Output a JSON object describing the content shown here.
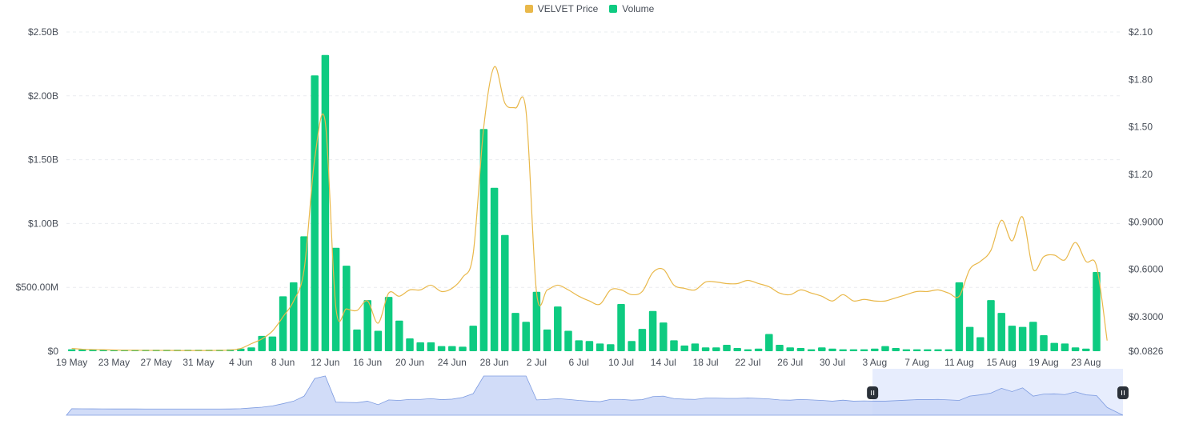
{
  "colors": {
    "price": "#f0b90b",
    "volume": "#0ecb81",
    "grid": "#eaecef",
    "navigator_fill": "#c9d6f7",
    "navigator_line": "#7d9be0",
    "navigator_window": "#e7edfd",
    "handle": "#2b3139"
  },
  "legend": [
    {
      "label": "VELVET Price",
      "color": "#e9b84a"
    },
    {
      "label": "Volume",
      "color": "#0ecb81"
    }
  ],
  "chart_data": {
    "type": "bar",
    "categories": [
      "19 May",
      "20 May",
      "21 May",
      "22 May",
      "23 May",
      "24 May",
      "25 May",
      "26 May",
      "27 May",
      "28 May",
      "29 May",
      "30 May",
      "31 May",
      "1 Jun",
      "2 Jun",
      "3 Jun",
      "4 Jun",
      "5 Jun",
      "6 Jun",
      "7 Jun",
      "8 Jun",
      "9 Jun",
      "10 Jun",
      "11 Jun",
      "12 Jun",
      "13 Jun",
      "14 Jun",
      "15 Jun",
      "16 Jun",
      "17 Jun",
      "18 Jun",
      "19 Jun",
      "20 Jun",
      "21 Jun",
      "22 Jun",
      "23 Jun",
      "24 Jun",
      "25 Jun",
      "26 Jun",
      "27 Jun",
      "28 Jun",
      "29 Jun",
      "30 Jun",
      "1 Jul",
      "2 Jul",
      "3 Jul",
      "4 Jul",
      "5 Jul",
      "6 Jul",
      "7 Jul",
      "8 Jul",
      "9 Jul",
      "10 Jul",
      "11 Jul",
      "12 Jul",
      "13 Jul",
      "14 Jul",
      "15 Jul",
      "16 Jul",
      "17 Jul",
      "18 Jul",
      "19 Jul",
      "20 Jul",
      "21 Jul",
      "22 Jul",
      "23 Jul",
      "24 Jul",
      "25 Jul",
      "26 Jul",
      "27 Jul",
      "28 Jul",
      "29 Jul",
      "30 Jul",
      "31 Jul",
      "1 Aug",
      "2 Aug",
      "3 Aug",
      "4 Aug",
      "5 Aug",
      "6 Aug",
      "7 Aug",
      "8 Aug",
      "9 Aug",
      "10 Aug",
      "11 Aug",
      "12 Aug",
      "13 Aug",
      "14 Aug",
      "15 Aug",
      "16 Aug",
      "17 Aug",
      "18 Aug",
      "19 Aug",
      "20 Aug",
      "21 Aug",
      "22 Aug",
      "23 Aug",
      "24 Aug",
      "25 Aug",
      "26 Aug"
    ],
    "x_tick_labels": [
      "19 May",
      "23 May",
      "27 May",
      "31 May",
      "4 Jun",
      "8 Jun",
      "12 Jun",
      "16 Jun",
      "20 Jun",
      "24 Jun",
      "28 Jun",
      "2 Jul",
      "6 Jul",
      "10 Jul",
      "14 Jul",
      "18 Jul",
      "22 Jul",
      "26 Jul",
      "30 Jul",
      "3 Aug",
      "7 Aug",
      "11 Aug",
      "15 Aug",
      "19 Aug",
      "23 Aug"
    ],
    "series": [
      {
        "name": "Volume",
        "axis": "left",
        "values_millions": [
          15,
          13,
          12,
          12,
          12,
          12,
          12,
          12,
          12,
          12,
          12,
          12,
          12,
          12,
          12,
          14,
          20,
          30,
          120,
          115,
          430,
          540,
          900,
          2160,
          2320,
          810,
          670,
          170,
          400,
          160,
          425,
          240,
          100,
          70,
          70,
          40,
          40,
          35,
          200,
          1740,
          1280,
          910,
          300,
          230,
          465,
          170,
          350,
          160,
          85,
          80,
          60,
          55,
          370,
          80,
          175,
          315,
          225,
          85,
          45,
          60,
          30,
          30,
          50,
          25,
          15,
          20,
          135,
          50,
          30,
          25,
          15,
          30,
          20,
          15,
          15,
          15,
          20,
          40,
          25,
          15,
          15,
          15,
          15,
          15,
          540,
          190,
          110,
          400,
          300,
          200,
          190,
          230,
          125,
          65,
          60,
          30,
          20,
          620
        ]
      },
      {
        "name": "VELVET Price",
        "axis": "right",
        "values": [
          0.1,
          0.095,
          0.093,
          0.092,
          0.09,
          0.089,
          0.089,
          0.088,
          0.088,
          0.088,
          0.087,
          0.087,
          0.087,
          0.087,
          0.088,
          0.09,
          0.1,
          0.13,
          0.16,
          0.21,
          0.3,
          0.4,
          0.6,
          1.3,
          1.53,
          0.36,
          0.35,
          0.34,
          0.4,
          0.26,
          0.45,
          0.43,
          0.47,
          0.47,
          0.5,
          0.46,
          0.48,
          0.55,
          0.7,
          1.5,
          1.88,
          1.65,
          1.62,
          1.6,
          0.45,
          0.47,
          0.5,
          0.47,
          0.43,
          0.4,
          0.38,
          0.47,
          0.47,
          0.44,
          0.46,
          0.58,
          0.6,
          0.5,
          0.48,
          0.47,
          0.52,
          0.52,
          0.51,
          0.51,
          0.53,
          0.51,
          0.49,
          0.45,
          0.44,
          0.47,
          0.45,
          0.43,
          0.4,
          0.44,
          0.4,
          0.41,
          0.4,
          0.4,
          0.42,
          0.44,
          0.46,
          0.46,
          0.47,
          0.45,
          0.43,
          0.6,
          0.65,
          0.72,
          0.91,
          0.78,
          0.93,
          0.6,
          0.68,
          0.69,
          0.66,
          0.77,
          0.65,
          0.62,
          0.15
        ]
      }
    ],
    "y_left": {
      "ticks": [
        "$0",
        "$500.00M",
        "$1.00B",
        "$1.50B",
        "$2.00B",
        "$2.50B"
      ],
      "range_millions": [
        0,
        2500
      ]
    },
    "y_right": {
      "ticks": [
        "$0.0826",
        "$0.3000",
        "$0.6000",
        "$0.9000",
        "$1.20",
        "$1.50",
        "$1.80",
        "$2.10"
      ],
      "range": [
        0.0826,
        2.1
      ]
    },
    "legend_position": "top-center",
    "grid": true,
    "navigator": true,
    "navigator_window_start_fraction": 0.763
  }
}
